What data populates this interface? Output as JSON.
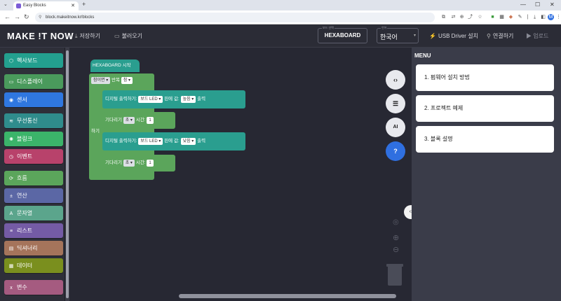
{
  "browser": {
    "tab_title": "Easy Blocks",
    "url": "block.makeitnow.kr/blocks",
    "avatar_text": "M"
  },
  "header": {
    "logo": "MAKE !T NOW",
    "save": "저장하기",
    "open": "불러오기",
    "board_label": "보드 선택",
    "board": "HEXABOARD",
    "lang_label": "언어",
    "language": "한국어",
    "usb_driver": "USB Driver 설치",
    "connect": "연결하기",
    "run": "업로드"
  },
  "palette": {
    "items": [
      {
        "label": "헥사보드",
        "icon": "hexaboard-icon",
        "color": "#23a08f"
      },
      {
        "label": "디스플레이",
        "icon": "display-icon",
        "color": "#4a9a5c"
      },
      {
        "label": "센서",
        "icon": "sensor-icon",
        "color": "#2f77e0"
      },
      {
        "label": "무선통신",
        "icon": "wifi-icon",
        "color": "#2f8c8c"
      },
      {
        "label": "블링크",
        "icon": "blink-icon",
        "color": "#3bb46a"
      },
      {
        "label": "이벤트",
        "icon": "event-icon",
        "color": "#b8426b"
      },
      {
        "label": "흐름",
        "icon": "flow-icon",
        "color": "#5ba55b"
      },
      {
        "label": "연산",
        "icon": "math-icon",
        "color": "#5b67a5"
      },
      {
        "label": "문자열",
        "icon": "text-icon",
        "color": "#5ba58c"
      },
      {
        "label": "리스트",
        "icon": "list-icon",
        "color": "#745ba5"
      },
      {
        "label": "딕셔너리",
        "icon": "dict-icon",
        "color": "#a5745b"
      },
      {
        "label": "데이터",
        "icon": "data-icon",
        "color": "#7a8f1e"
      },
      {
        "label": "변수",
        "icon": "variable-icon",
        "color": "#a55b80"
      }
    ]
  },
  "workspace": {
    "start_block": "HEXABOARD 시작",
    "repeat_block_a": "참이면",
    "repeat_block_b": "반복",
    "repeat_value": "참",
    "do_label": "하기",
    "digital_write_1_a": "디지털 출력하기:",
    "digital_write_1_pin": "보드 LED",
    "digital_write_1_b": "핀에 값:",
    "digital_write_1_val": "높음",
    "digital_write_1_c": "출력",
    "wait_1_a": "기다리기",
    "wait_1_unit": "초",
    "wait_1_b": "시간:",
    "wait_1_val": "1",
    "digital_write_2_a": "디지털 출력하기:",
    "digital_write_2_pin": "보드 LED",
    "digital_write_2_b": "핀에 값:",
    "digital_write_2_val": "낮음",
    "digital_write_2_c": "출력",
    "wait_2_a": "기다리기",
    "wait_2_unit": "초",
    "wait_2_b": "시간:",
    "wait_2_val": "1",
    "ai_label": "AI"
  },
  "menu": {
    "title": "MENU",
    "items": [
      "1. 펌웨어 설치 방법",
      "2. 프로젝트 예제",
      "3. 블록 설명"
    ]
  }
}
